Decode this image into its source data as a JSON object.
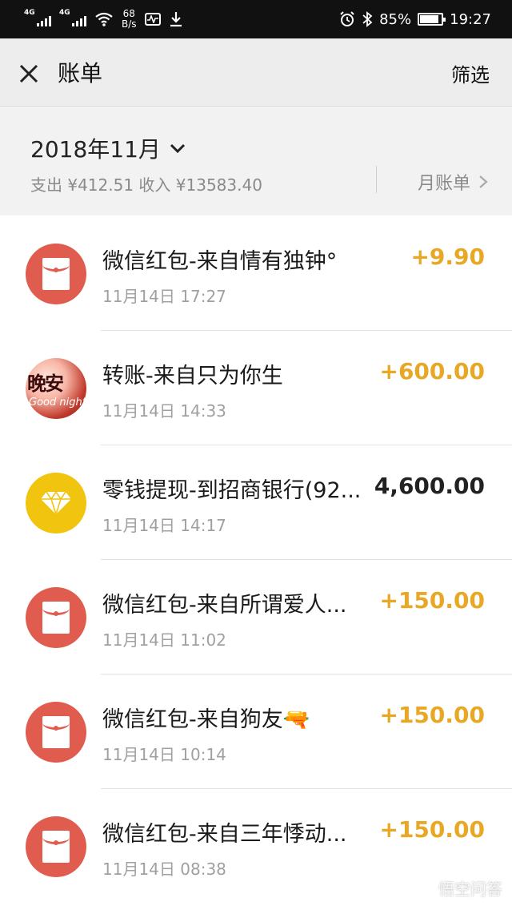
{
  "status_bar": {
    "network_1": "4G",
    "network_2": "4G",
    "speed_value": "68",
    "speed_unit": "B/s",
    "battery": "85%",
    "time": "19:27"
  },
  "nav": {
    "title": "账单",
    "filter_label": "筛选"
  },
  "summary": {
    "month": "2018年11月",
    "totals": "支出 ¥412.51 收入 ¥13583.40",
    "monthly_bill_label": "月账单"
  },
  "transactions": [
    {
      "title": "微信红包-来自情有独钟°",
      "time": "11月14日 17:27",
      "amount": "+9.90",
      "avatar": "red-envelope-icon",
      "direction": "in"
    },
    {
      "title": "转账-来自只为你生",
      "time": "11月14日 14:33",
      "amount": "+600.00",
      "avatar": "user-photo",
      "direction": "in"
    },
    {
      "title": "零钱提现-到招商银行(92...",
      "time": "11月14日 14:17",
      "amount": "4,600.00",
      "avatar": "diamond-icon",
      "direction": "out"
    },
    {
      "title": "微信红包-来自所谓爱人...",
      "time": "11月14日 11:02",
      "amount": "+150.00",
      "avatar": "red-envelope-icon",
      "direction": "in"
    },
    {
      "title": "微信红包-来自狗友🔫",
      "time": "11月14日 10:14",
      "amount": "+150.00",
      "avatar": "red-envelope-icon",
      "direction": "in"
    },
    {
      "title": "微信红包-来自三年悸动...",
      "time": "11月14日 08:38",
      "amount": "+150.00",
      "avatar": "red-envelope-icon",
      "direction": "in"
    }
  ],
  "avatar_photo_text": {
    "line1": "晚安",
    "line2": "Good night"
  },
  "watermark": "悟空问答",
  "colors": {
    "income": "#e8a825",
    "expense": "#222222",
    "red_envelope": "#e05c4e",
    "diamond": "#f1c40f"
  }
}
